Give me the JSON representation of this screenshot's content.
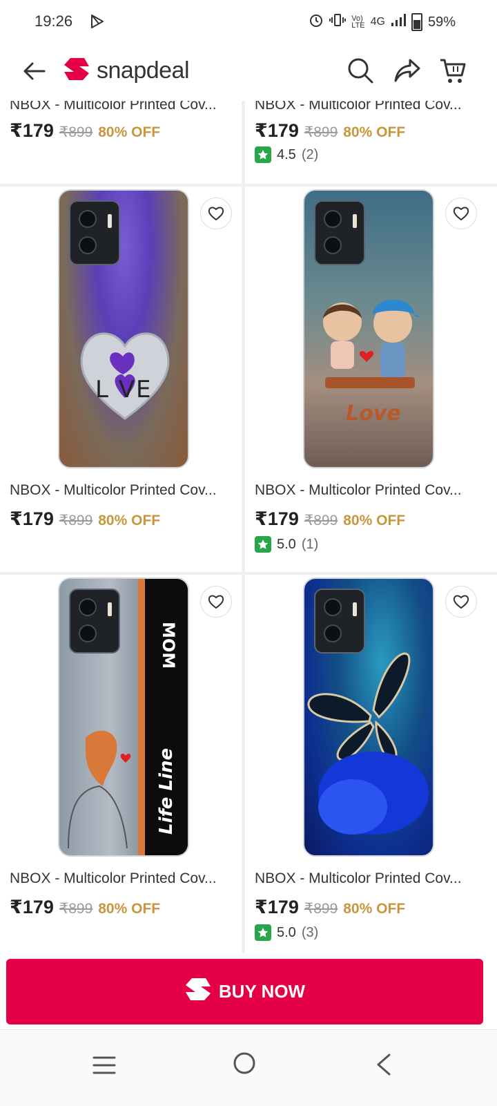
{
  "status_bar": {
    "time": "19:26",
    "network": "4G",
    "battery": "59%"
  },
  "header": {
    "brand": "snapdeal"
  },
  "products": [
    {
      "title": "NBOX - Multicolor Printed Cov...",
      "price": "₹179",
      "mrp": "₹899",
      "discount": "80% OFF",
      "rating": "",
      "rating_count": ""
    },
    {
      "title": "NBOX - Multicolor Printed Cov...",
      "price": "₹179",
      "mrp": "₹899",
      "discount": "80% OFF",
      "rating": "4.5",
      "rating_count": "(2)"
    },
    {
      "title": "NBOX - Multicolor Printed Cov...",
      "price": "₹179",
      "mrp": "₹899",
      "discount": "80% OFF",
      "rating": "",
      "rating_count": "",
      "image_text": "L VE"
    },
    {
      "title": "NBOX - Multicolor Printed Cov...",
      "price": "₹179",
      "mrp": "₹899",
      "discount": "80% OFF",
      "rating": "5.0",
      "rating_count": "(1)",
      "image_text": "Love"
    },
    {
      "title": "NBOX - Multicolor Printed Cov...",
      "price": "₹179",
      "mrp": "₹899",
      "discount": "80% OFF",
      "rating": "",
      "rating_count": "",
      "image_text": "Life Line",
      "image_text_2": "MOM"
    },
    {
      "title": "NBOX - Multicolor Printed Cov...",
      "price": "₹179",
      "mrp": "₹899",
      "discount": "80% OFF",
      "rating": "5.0",
      "rating_count": "(3)"
    }
  ],
  "buy_button": {
    "label": "BUY NOW"
  },
  "colors": {
    "brand": "#e40046",
    "discount": "#c8963e",
    "rating_badge": "#27a64a"
  }
}
